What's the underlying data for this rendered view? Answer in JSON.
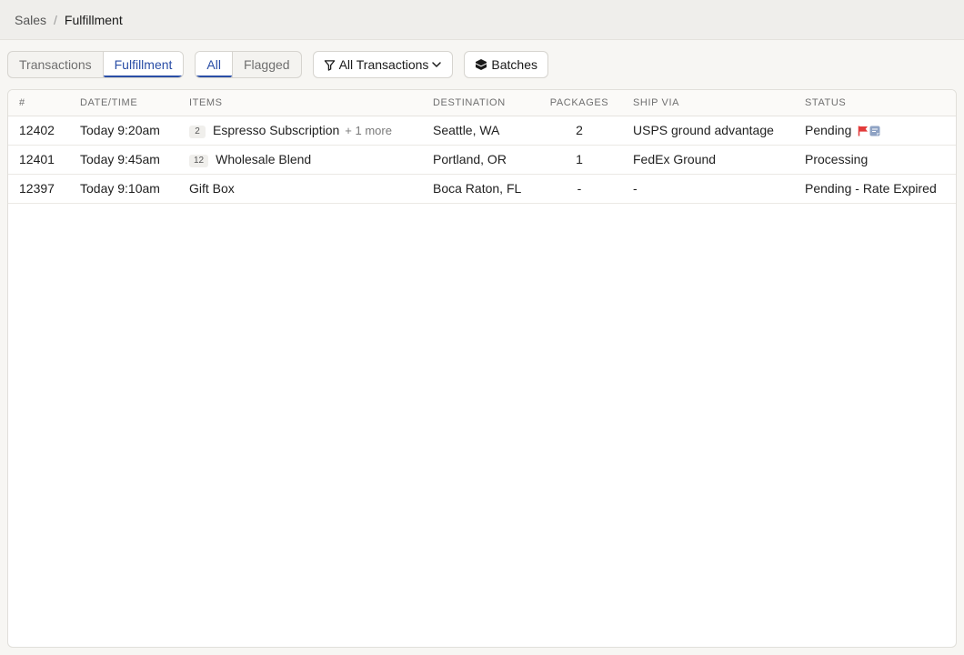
{
  "breadcrumb": {
    "parent": "Sales",
    "separator": "/",
    "current": "Fulfillment"
  },
  "view_tabs": [
    {
      "label": "Transactions",
      "active": false
    },
    {
      "label": "Fulfillment",
      "active": true
    }
  ],
  "filter_tabs": [
    {
      "label": "All",
      "active": true
    },
    {
      "label": "Flagged",
      "active": false
    }
  ],
  "transactions_filter": {
    "label": "All Transactions",
    "icon": "filter-icon"
  },
  "batches_button": {
    "label": "Batches",
    "icon": "box-icon"
  },
  "table": {
    "columns": [
      "#",
      "DATE/TIME",
      "ITEMS",
      "DESTINATION",
      "PACKAGES",
      "SHIP VIA",
      "STATUS"
    ],
    "rows": [
      {
        "id": "12402",
        "datetime": "Today 9:20am",
        "qty": "2",
        "item": "Espresso Subscription",
        "more": "+ 1 more",
        "destination": "Seattle, WA",
        "packages": "2",
        "ship_via": "USPS ground advantage",
        "status": "Pending",
        "flagged": true,
        "has_note": true
      },
      {
        "id": "12401",
        "datetime": "Today 9:45am",
        "qty": "12",
        "item": "Wholesale Blend",
        "more": "",
        "destination": "Portland, OR",
        "packages": "1",
        "ship_via": "FedEx Ground",
        "status": "Processing",
        "flagged": false,
        "has_note": false
      },
      {
        "id": "12397",
        "datetime": "Today 9:10am",
        "qty": "",
        "item": "Gift Box",
        "more": "",
        "destination": "Boca Raton, FL",
        "packages": "-",
        "ship_via": "-",
        "status": "Pending - Rate Expired",
        "flagged": false,
        "has_note": false
      }
    ]
  },
  "colors": {
    "accent": "#2a4ea6",
    "flag": "#e23b3b",
    "note": "#8fa3c4"
  }
}
